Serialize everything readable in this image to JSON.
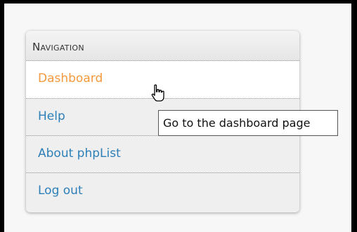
{
  "nav": {
    "heading": "Navigation",
    "items": [
      {
        "label": "Dashboard",
        "active": true
      },
      {
        "label": "Help"
      },
      {
        "label": "About phpList"
      },
      {
        "label": "Log out"
      }
    ]
  },
  "tooltip": {
    "text": "Go to the dashboard page"
  },
  "cursor": {
    "icon": "hand-pointer-icon"
  },
  "colors": {
    "link": "#2d7fb8",
    "active_link": "#f5993c",
    "panel_bg": "#efefef"
  }
}
